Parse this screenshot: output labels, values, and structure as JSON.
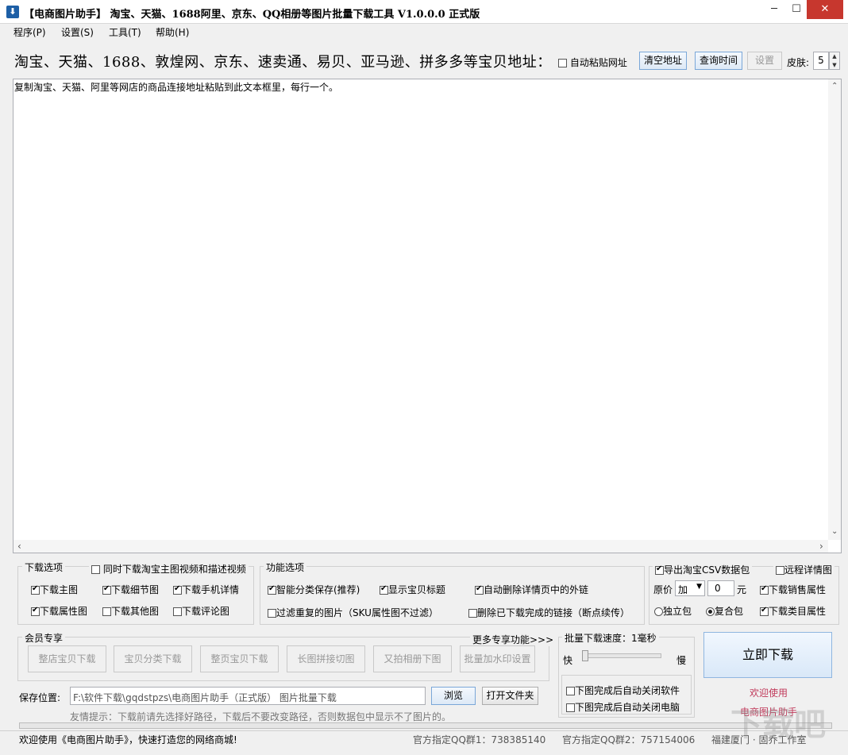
{
  "window": {
    "icon": "download-icon",
    "title": "【电商图片助手】 淘宝、天猫、1688阿里、京东、QQ相册等图片批量下载工具 V1.0.0.0 正式版",
    "minimize": "─",
    "maximize": "☐",
    "close": "✕"
  },
  "menu": [
    "程序(P)",
    "设置(S)",
    "工具(T)",
    "帮助(H)"
  ],
  "toolbar": {
    "url_label": "淘宝、天猫、1688、敦煌网、京东、速卖通、易贝、亚马逊、拼多多等宝贝地址：",
    "auto_paste": "自动粘贴网址",
    "clear_btn": "清空地址",
    "query_btn": "查询时间",
    "settings_btn": "设置",
    "skin_label": "皮肤:",
    "skin_value": "5"
  },
  "editor": {
    "hint": "复制淘宝、天猫、阿里等网店的商品连接地址粘贴到此文本框里，每行一个。"
  },
  "download_options": {
    "title": "下载选项",
    "video_check": "同时下载淘宝主图视频和描述视频",
    "items": [
      {
        "label": "下载主图",
        "checked": true
      },
      {
        "label": "下载细节图",
        "checked": true
      },
      {
        "label": "下载手机详情",
        "checked": true
      },
      {
        "label": "下载属性图",
        "checked": true
      },
      {
        "label": "下载其他图",
        "checked": false
      },
      {
        "label": "下载评论图",
        "checked": false
      }
    ]
  },
  "function_options": {
    "title": "功能选项",
    "items": [
      {
        "label": "智能分类保存(推荐)",
        "checked": true
      },
      {
        "label": "显示宝贝标题",
        "checked": true
      },
      {
        "label": "自动删除详情页中的外链",
        "checked": true
      },
      {
        "label": "过滤重复的图片（SKU属性图不过滤）",
        "checked": false
      },
      {
        "label": "删除已下载完成的链接（断点续传）",
        "checked": false
      }
    ]
  },
  "export_options": {
    "export_csv": "导出淘宝CSV数据包",
    "remote_detail": "远程详情图",
    "price_label": "原价",
    "price_op": "加",
    "price_value": "0",
    "price_unit": "元",
    "sales_attr": "下载销售属性",
    "standalone": "独立包",
    "combined": "复合包",
    "category_attr": "下载类目属性"
  },
  "member": {
    "title": "会员专享",
    "more": "更多专享功能>>>",
    "buttons": [
      "整店宝贝下载",
      "宝贝分类下载",
      "整页宝贝下载",
      "长图拼接切图",
      "又拍相册下图",
      "批量加水印设置"
    ]
  },
  "speed": {
    "title": "批量下载速度：1毫秒",
    "fast": "快",
    "slow": "慢",
    "level": 0.0,
    "close_app": "下图完成后自动关闭软件",
    "close_pc": "下图完成后自动关闭电脑"
  },
  "save": {
    "label": "保存位置:",
    "path": "F:\\软件下载\\gqdstpzs\\电商图片助手（正式版） 图片批量下载",
    "browse": "浏览",
    "open_folder": "打开文件夹",
    "tip": "友情提示：下载前请先选择好路径，下载后不要改变路径，否则数据包中显示不了图片的。"
  },
  "actions": {
    "download_now": "立即下载",
    "welcome1": "欢迎使用",
    "welcome2": "电商图片助手"
  },
  "status": {
    "message": "欢迎使用《电商图片助手》，快速打造您的网络商城!",
    "qq1": "官方指定QQ群1：738385140",
    "qq2": "官方指定QQ群2：757154006",
    "company": "福建厦门 · 固乔工作室"
  },
  "watermark": "下载吧",
  "colors": {
    "close_bg": "#c7372e",
    "welcome": "#c0395a",
    "accent_border": "#7aa7d8"
  }
}
